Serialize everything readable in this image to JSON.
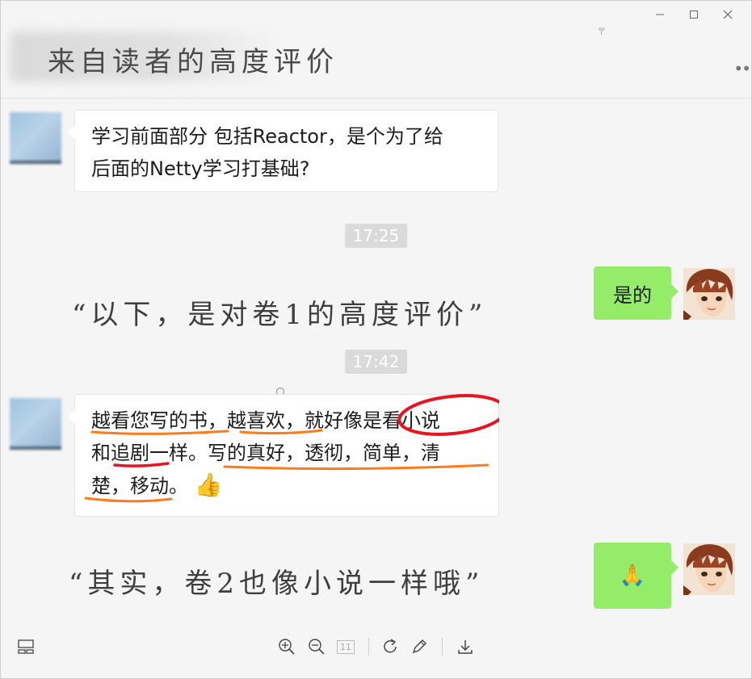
{
  "window": {
    "controls": [
      "minimize",
      "maximize",
      "close"
    ],
    "header_title": "来自读者的高度评价"
  },
  "messages": [
    {
      "side": "left",
      "lines": [
        "学习前面部分 包括Reactor，是个为了给",
        "后面的Netty学习打基础?"
      ]
    },
    {
      "type": "timestamp",
      "text": "17:25"
    },
    {
      "side": "right",
      "text": "是的"
    },
    {
      "type": "timestamp",
      "text": "17:42"
    },
    {
      "side": "left",
      "lines": [
        "越看您写的书，越喜欢，就好像是看小说",
        "和追剧一样。写的真好，透彻，简单，清",
        "楚，移动。"
      ],
      "emoji": "👍"
    },
    {
      "side": "right",
      "emoji": "🙏"
    }
  ],
  "overlay_captions": [
    "“以下，是对卷1的高度评价”",
    "“其实，卷2也像小说一样哦”"
  ],
  "toolbar": {
    "icons": [
      "layout-icon",
      "zoom-in-icon",
      "zoom-out-icon",
      "actual-size-icon",
      "rotate-icon",
      "edit-icon",
      "download-icon"
    ],
    "actual_size_label": "11"
  },
  "colors": {
    "bubble_self": "#95ec69",
    "bubble_other": "#ffffff",
    "timestamp_bg": "#dadada",
    "underline_orange": "#ff7a1a",
    "underline_red": "#e8141e"
  }
}
